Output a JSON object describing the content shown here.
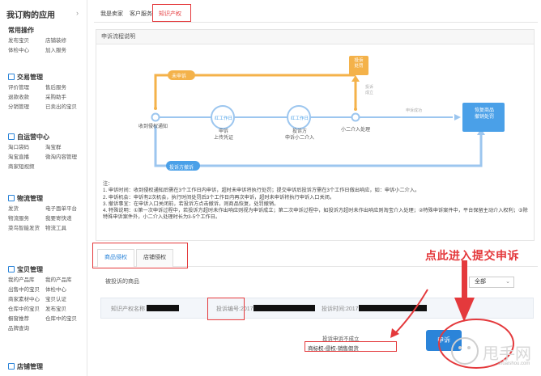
{
  "sidebar": {
    "title": "我订购的应用",
    "groups": [
      {
        "title": "常用操作",
        "has_icon": false,
        "links": [
          "发布宝贝",
          "店铺装修",
          "体检中心",
          "加入服务"
        ]
      },
      {
        "title": "交易管理",
        "has_icon": true,
        "links": [
          "评价管理",
          "售后服务",
          "退款收款",
          "采购助手",
          "分销管理",
          "已卖出的宝贝"
        ]
      },
      {
        "title": "自运营中心",
        "has_icon": true,
        "links": [
          "淘口袋码",
          "淘宝群",
          "淘宝直播",
          "微淘内容管理",
          "商家短视频"
        ]
      },
      {
        "title": "物流管理",
        "has_icon": true,
        "links": [
          "发货",
          "电子面单平台",
          "物流服务",
          "我要寄快递",
          "菜鸟智能发货",
          "物流工具"
        ]
      },
      {
        "title": "宝贝管理",
        "has_icon": true,
        "links": [
          "我的产品库",
          "我的产品库",
          "出售中的宝贝",
          "体检中心",
          "商家素材中心",
          "宝贝认证",
          "仓库中的宝贝",
          "发布宝贝",
          "橱窗推荐",
          "仓库中的宝贝",
          "品牌查询"
        ]
      },
      {
        "title": "店铺管理",
        "has_icon": true,
        "links": []
      }
    ]
  },
  "topnav": {
    "tabs": [
      "我是卖家",
      "客户服务",
      "知识产权"
    ],
    "active_index": 2
  },
  "process": {
    "header": "申诉流程说明",
    "nodes": {
      "receive": "收到侵权通知",
      "appeal1_tag": "红工作日",
      "appeal1": "申诉\n上传凭证",
      "appeal2_tag": "红工作日",
      "appeal2": "投诉方\n申诉小二介入",
      "judge": "小二介入处理",
      "penalty": "投诉\n处罚",
      "revoke": "恢复商品\n撤销处罚",
      "not_appealed": "未申诉",
      "complaint_success": "投诉\n成立",
      "appeal_success": "申诉成功",
      "complainant_withdraw": "投诉方撤诉"
    },
    "notes": [
      "注：",
      "1. 申诉时间：收到侵权通知后需在3个工作日内申诉，超时未申诉将执行处罚；提交申诉后投诉方需在3个工作日做出响应，如：申诉小二介入。",
      "2. 申诉机会：申诉有2次机会，执行时间处罚后3个工作日内再次申诉，超时未申诉将执行申诉入口关闭。",
      "3. 撤诉事宜：在申诉入口关闭前，若投诉方点击撤诉，则商品恢复，处罚撤销。",
      "4. 特殊说明：①第一次申诉过程中，若投诉方超时未作出响应则视为申诉成立；第二次申诉过程中，如投诉方超时未作出响应则淘宝介入处理；②特殊申诉案件中，平台保留主动介入权利；③除特殊申诉案件外，小二介入处理时长为3-5个工作日。"
    ]
  },
  "subtabs": {
    "items": [
      "商品侵权",
      "店铺侵权"
    ],
    "active_index": 0
  },
  "reported_label": "被投诉的商品",
  "filter_select": {
    "value": "全部"
  },
  "record": {
    "ip_name_label": "知识产权名称",
    "complaint_no_label": "投诉编号:2017",
    "complaint_time_label": "投诉时间:2017"
  },
  "actions": {
    "complaint_button": "申诉",
    "option_not_valid": "投诉申诉不成立",
    "option_trademark": "商标权-侵权-销售假货"
  },
  "annotation": "点此进入提交申诉",
  "watermark": {
    "glyphs": "甩手网",
    "text": "shuaishou.com"
  },
  "colors": {
    "accent": "#2b84d9",
    "flow_blue": "#9cc6ef",
    "flow_orange": "#f4b24a",
    "alert_red": "#e4393c"
  }
}
